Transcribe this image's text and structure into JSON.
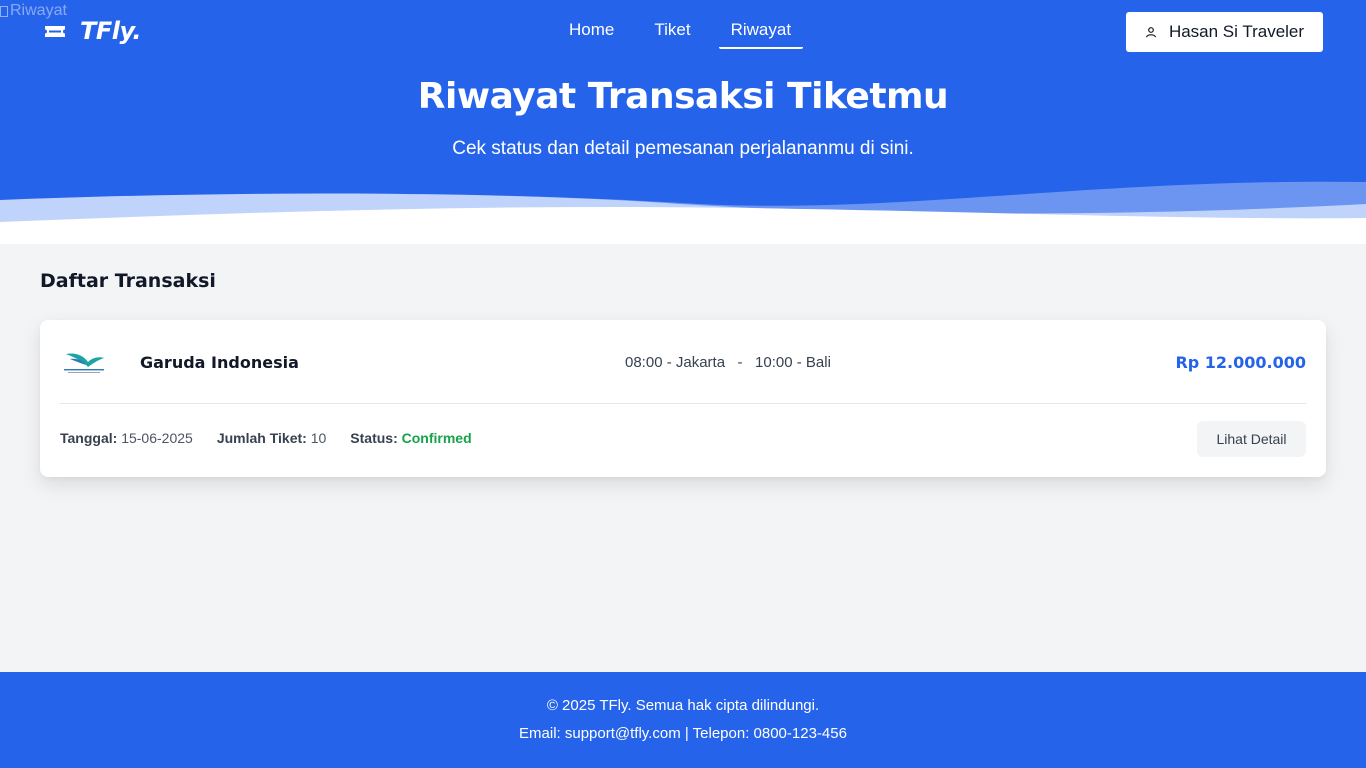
{
  "broken_image_alt": "Riwayat",
  "brand": {
    "name": "TFly.",
    "icon": "ticket-icon"
  },
  "nav": {
    "items": [
      {
        "label": "Home",
        "active": false
      },
      {
        "label": "Tiket",
        "active": false
      },
      {
        "label": "Riwayat",
        "active": true
      }
    ]
  },
  "user": {
    "label": "Hasan Si Traveler",
    "icon": "user-icon"
  },
  "hero": {
    "title": "Riwayat Transaksi Tiketmu",
    "subtitle": "Cek status dan detail pemesanan perjalananmu di sini."
  },
  "section": {
    "title": "Daftar Transaksi"
  },
  "transactions": [
    {
      "airline": "Garuda Indonesia",
      "logo_icon": "garuda-indonesia-logo",
      "route": "08:00 - Jakarta   -   10:00 - Bali",
      "price": "Rp 12.000.000",
      "date_label": "Tanggal:",
      "date": "15-06-2025",
      "qty_label": "Jumlah Tiket:",
      "qty": "10",
      "status_label": "Status:",
      "status": "Confirmed",
      "detail_button": "Lihat Detail"
    }
  ],
  "footer": {
    "copyright": "© 2025 TFly. Semua hak cipta dilindungi.",
    "contact": "Email: support@tfly.com | Telepon: 0800-123-456"
  },
  "colors": {
    "primary": "#2563eb",
    "background": "#f3f4f6",
    "status_confirmed": "#16a34a",
    "card": "#ffffff"
  }
}
